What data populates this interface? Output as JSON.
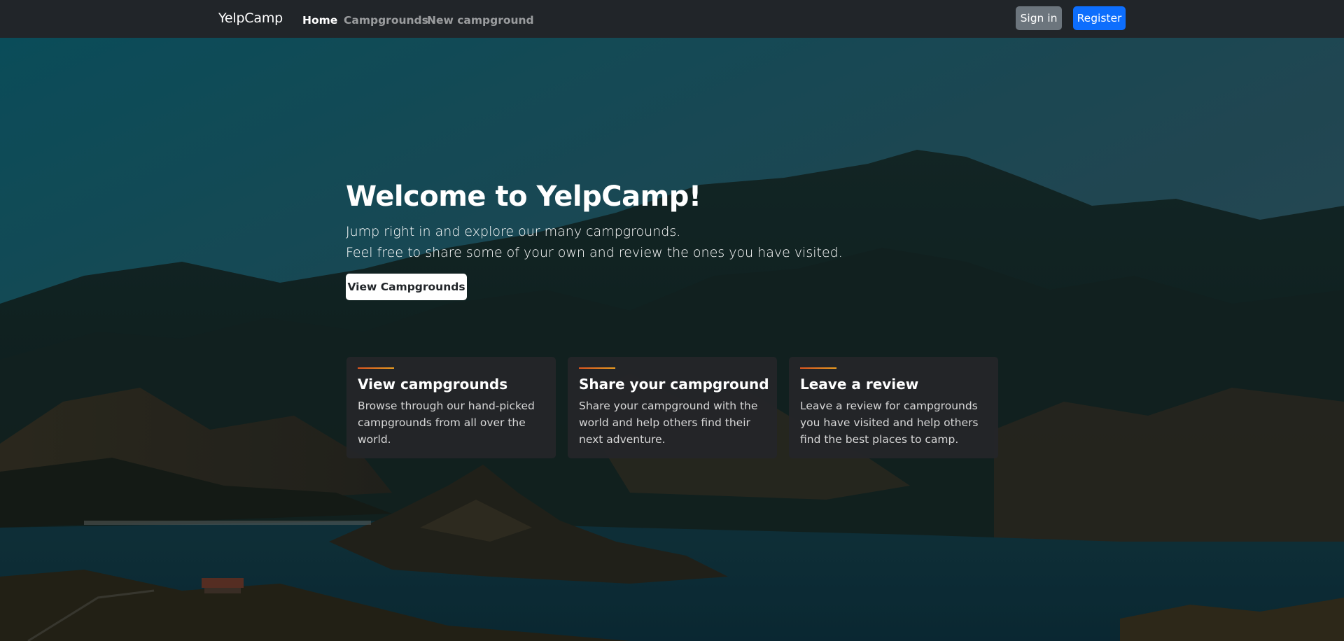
{
  "navbar": {
    "brand": "YelpCamp",
    "links": [
      {
        "label": "Home",
        "active": true
      },
      {
        "label": "Campgrounds",
        "active": false
      },
      {
        "label": "New campground",
        "active": false
      }
    ],
    "sign_in_label": "Sign in",
    "register_label": "Register"
  },
  "hero": {
    "title": "Welcome to YelpCamp!",
    "line1": "Jump right in and explore our many campgrounds.",
    "line2": "Feel free to share some of your own and review the ones you have visited.",
    "cta_label": "View Campgrounds"
  },
  "cards": [
    {
      "title": "View campgrounds",
      "text": "Browse through our hand-picked campgrounds from all over the world."
    },
    {
      "title": "Share your campground",
      "text": "Share your campground with the world and help others find their next adventure."
    },
    {
      "title": "Leave a review",
      "text": "Leave a review for campgrounds you have visited and help others find the best places to camp."
    }
  ],
  "colors": {
    "navbar_bg": "#212529",
    "primary": "#0d6efd",
    "secondary": "#6c757d",
    "accent_start": "#e0561f",
    "accent_end": "#f0a020"
  }
}
